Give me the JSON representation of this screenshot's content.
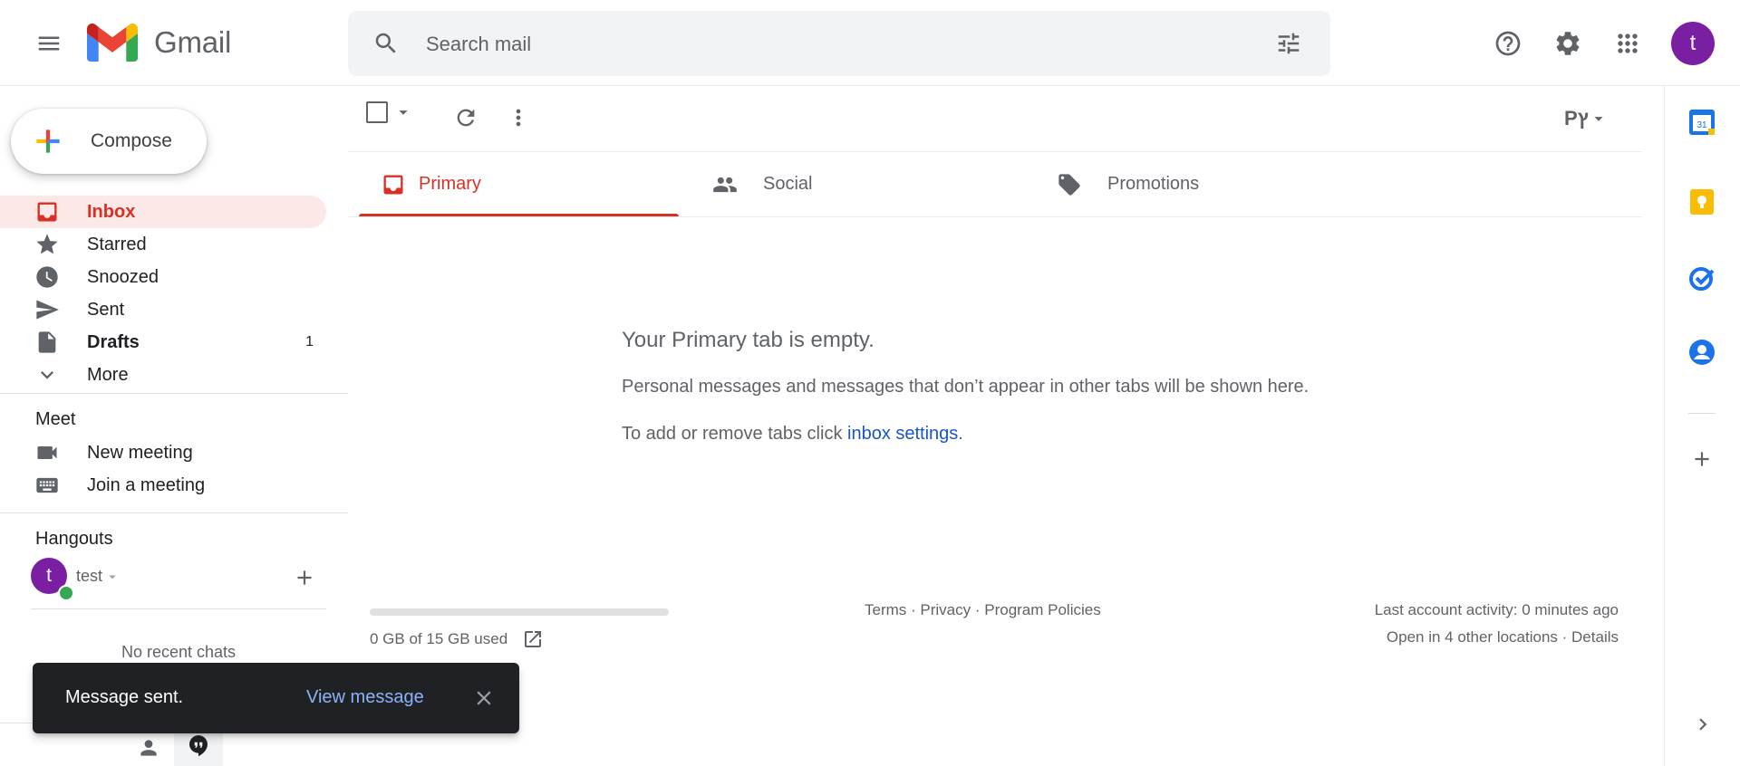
{
  "app": {
    "name": "Gmail"
  },
  "header": {
    "search_placeholder": "Search mail",
    "avatar_letter": "t",
    "avatar_color": "#7b1fa2"
  },
  "sidebar": {
    "compose_label": "Compose",
    "items": [
      {
        "label": "Inbox",
        "icon": "inbox-icon",
        "count": "",
        "active": true
      },
      {
        "label": "Starred",
        "icon": "star-icon",
        "count": ""
      },
      {
        "label": "Snoozed",
        "icon": "clock-icon",
        "count": ""
      },
      {
        "label": "Sent",
        "icon": "send-icon",
        "count": ""
      },
      {
        "label": "Drafts",
        "icon": "draft-icon",
        "count": "1"
      },
      {
        "label": "More",
        "icon": "chevron-down-icon",
        "count": ""
      }
    ],
    "meet": {
      "title": "Meet",
      "items": [
        {
          "label": "New meeting",
          "icon": "video-icon"
        },
        {
          "label": "Join a meeting",
          "icon": "keyboard-icon"
        }
      ]
    },
    "hangouts": {
      "title": "Hangouts",
      "user_name": "test",
      "avatar_letter": "t",
      "no_chats": "No recent chats"
    }
  },
  "toolbar": {
    "input_tool": "Рץ"
  },
  "tabs": [
    {
      "label": "Primary",
      "icon": "inbox-icon",
      "active": true
    },
    {
      "label": "Social",
      "icon": "people-icon"
    },
    {
      "label": "Promotions",
      "icon": "tag-icon"
    }
  ],
  "empty_state": {
    "title": "Your Primary tab is empty.",
    "description": "Personal messages and messages that don’t appear in other tabs will be shown here.",
    "settings_prefix": "To add or remove tabs click ",
    "settings_link": "inbox settings",
    "settings_suffix": "."
  },
  "footer": {
    "storage_text": "0 GB of 15 GB used",
    "storage_fraction": 0,
    "links": [
      "Terms",
      "Privacy",
      "Program Policies"
    ],
    "separator": " · ",
    "activity": "Last account activity: 0 minutes ago",
    "other_locations": "Open in 4 other locations",
    "details_link": "Details"
  },
  "snackbar": {
    "message": "Message sent.",
    "action": "View message"
  },
  "right_rail": {
    "apps": [
      "calendar-icon",
      "keep-icon",
      "tasks-icon",
      "contacts-icon"
    ],
    "calendar_day": "31"
  },
  "colors": {
    "accent_red": "#d93025",
    "link_blue": "#1a55c8",
    "snackbar_bg": "#202124",
    "snackbar_action": "#8ab4f8"
  }
}
